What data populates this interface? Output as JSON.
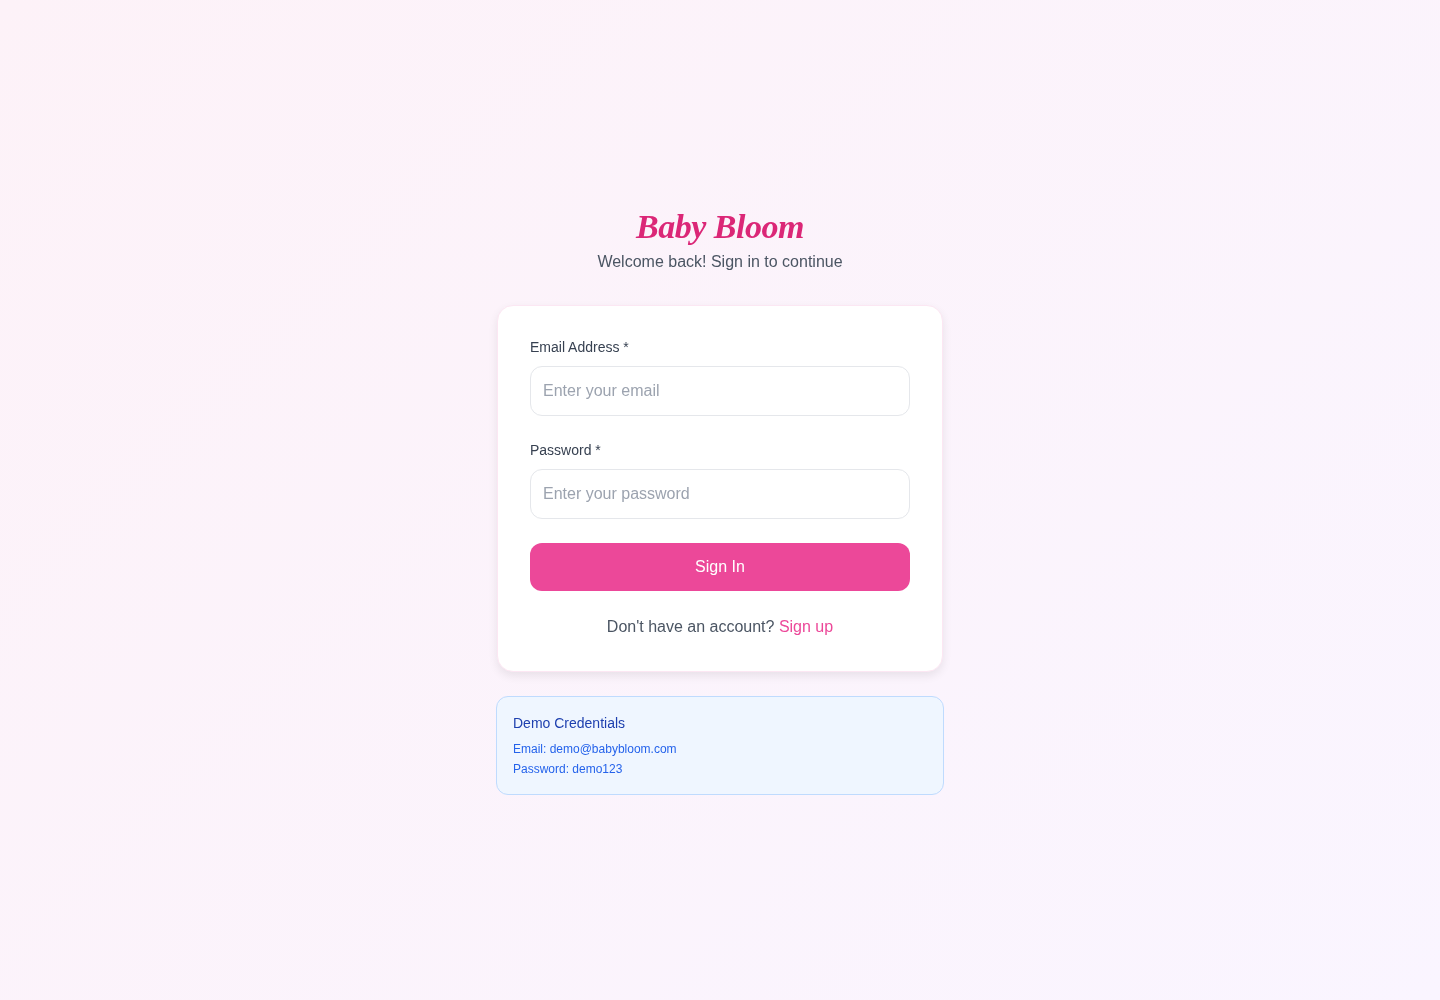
{
  "brand": {
    "logo": "Baby Bloom",
    "subtitle": "Welcome back! Sign in to continue"
  },
  "form": {
    "fields": [
      {
        "label": "Email Address *",
        "placeholder": "Enter your email"
      },
      {
        "label": "Password *",
        "placeholder": "Enter your password"
      }
    ],
    "submit": "Sign In",
    "signup_prompt": "Don't have an account?",
    "signup_link": "Sign up"
  },
  "demo": {
    "title": "Demo Credentials",
    "lines": [
      "Email: demo@babybloom.com",
      "Password: demo123"
    ]
  }
}
